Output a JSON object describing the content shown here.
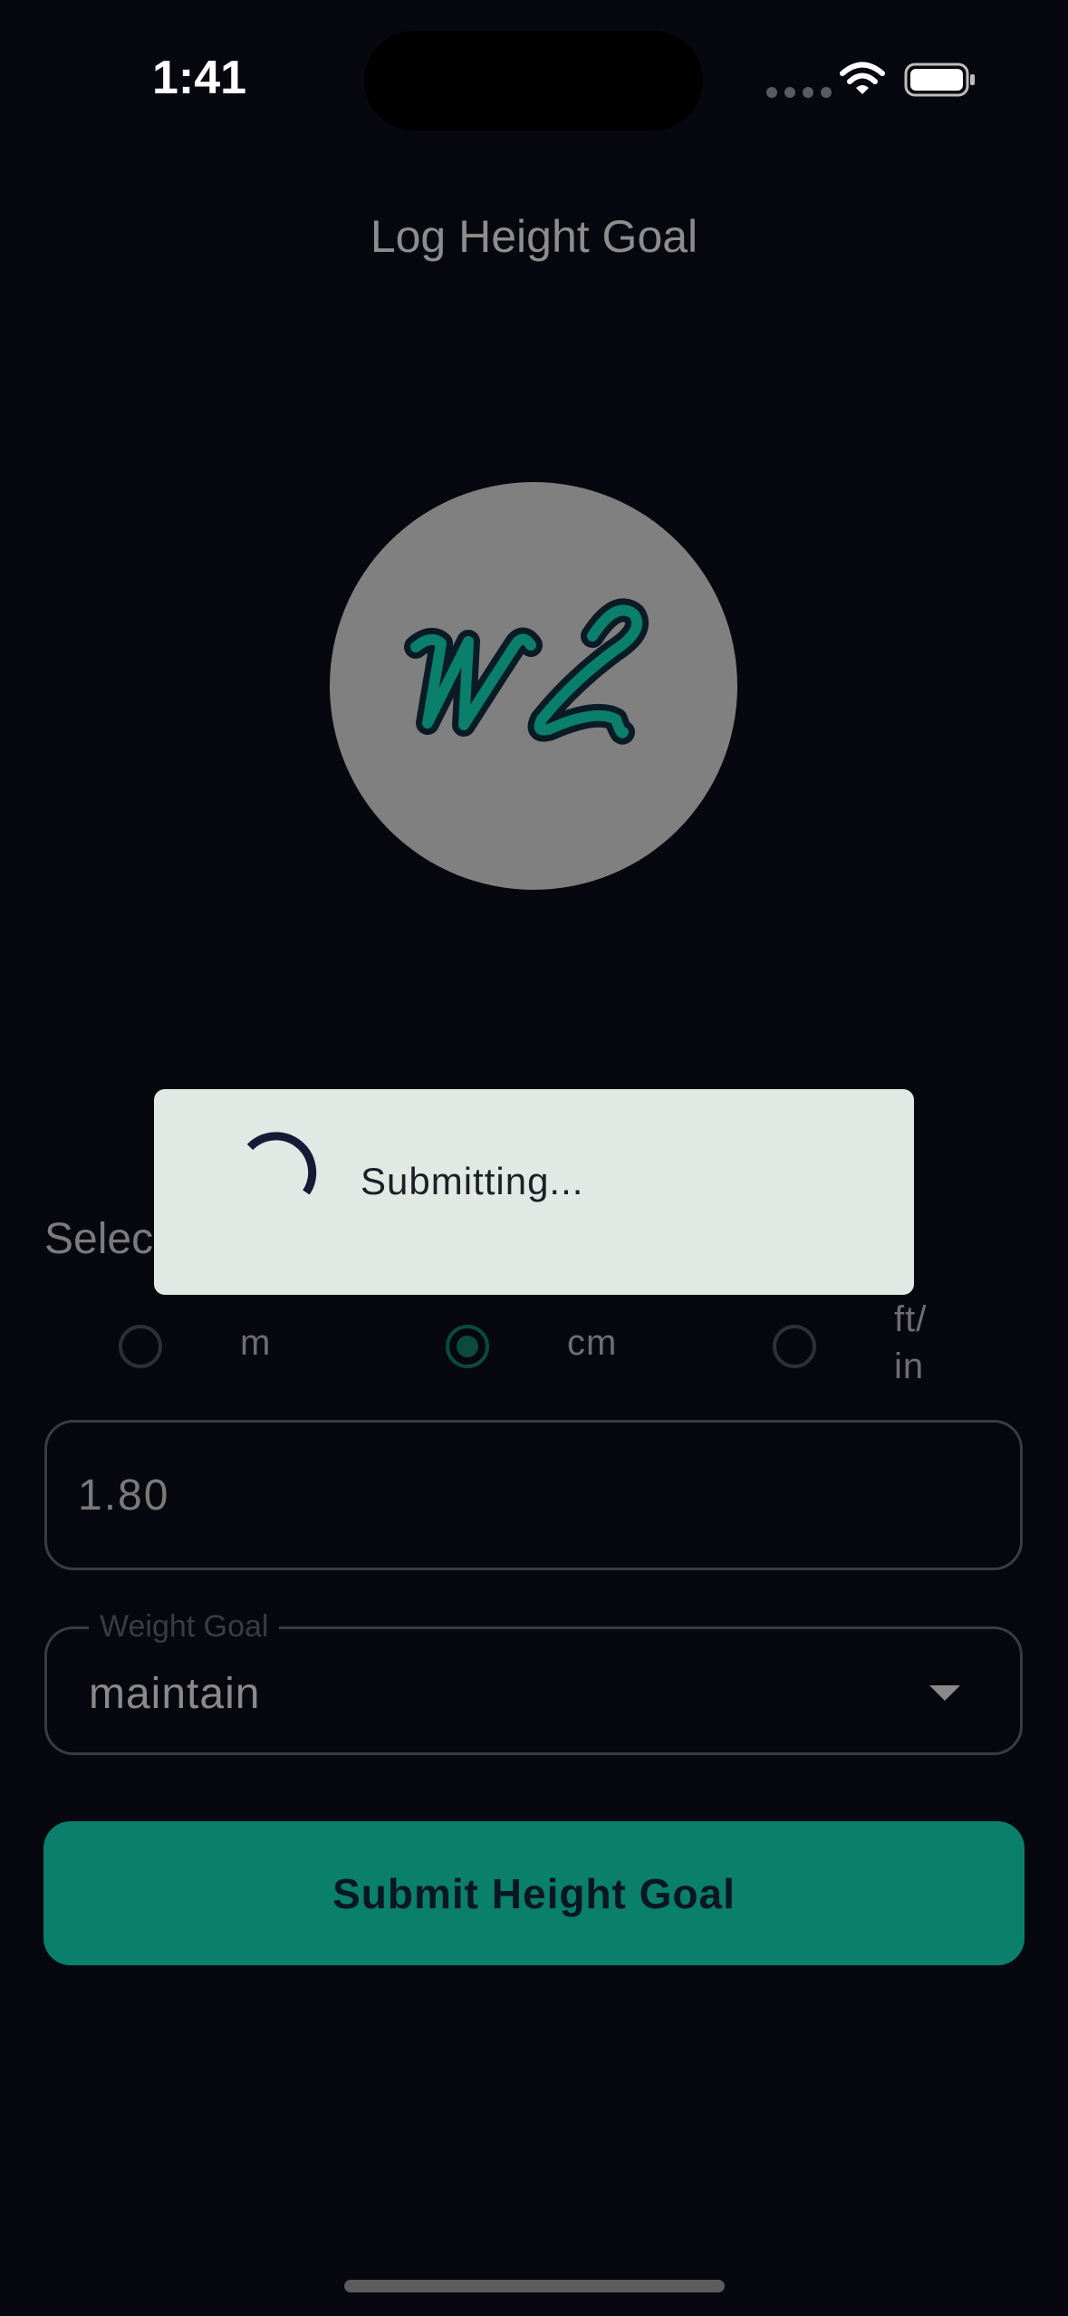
{
  "status_bar": {
    "time": "1:41"
  },
  "page": {
    "title": "Log Height Goal"
  },
  "logo": {
    "icon": "wl-monogram-logo",
    "text": "WL",
    "circle_color": "#808080",
    "monogram_color": "#0a7f6b"
  },
  "units": {
    "label": "Selec",
    "options": [
      {
        "label": "m",
        "selected": false
      },
      {
        "label": "cm",
        "selected": true
      },
      {
        "label": "ft/\nin",
        "selected": false
      }
    ]
  },
  "height_input": {
    "value": "1.80"
  },
  "weight_goal": {
    "label": "Weight Goal",
    "value": "maintain"
  },
  "submit": {
    "label": "Submit Height Goal"
  },
  "loading": {
    "text": "Submitting..."
  },
  "colors": {
    "background": "#07070f",
    "accent": "#0a7f6b",
    "dialog": "#e1e9e4"
  }
}
